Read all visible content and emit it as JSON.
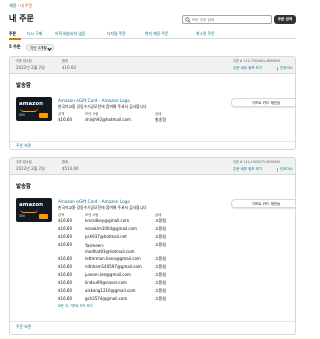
{
  "breadcrumb": {
    "account": "계정",
    "separator": "›",
    "current": "내 주문"
  },
  "page_title": "내 주문",
  "search": {
    "placeholder": "모든 주문 검색",
    "button_label": "주문 검색"
  },
  "tabs": [
    "주문",
    "다시 구매",
    "아직 배송되지 않음",
    "디지털 주문",
    "현지 매장 주문",
    "취소된 주문"
  ],
  "summary": {
    "count": "5 주문",
    "range": "지난 3개월"
  },
  "orders": [
    {
      "header": {
        "placed_label": "주문 접수됨",
        "placed_value": "2022년 2월 2일",
        "total_label": "합계",
        "total_value": "$16.60",
        "order_number": "주문 # 112-7553061-4609025",
        "details_link": "주문 세부 정보 보기",
        "invoice_link": "인보이스"
      },
      "status": "발송함",
      "product_link": "Amazon eGift Card - Amazon Logo",
      "message": "한국어교환 강동수기공모전에 참여해 주셔서 감사합니다",
      "amount_label": "금액",
      "to_label": "보낸 사람",
      "status_label": "상태",
      "rows": [
        {
          "amount": "$16.60",
          "recipient": "shinjh92@hotmail.com",
          "status": "발송함"
        }
      ],
      "gift_button": "기프트 카드 재전송",
      "footer_link": "주문 보관"
    },
    {
      "header": {
        "placed_label": "주문 접수됨",
        "placed_value": "2022년 2월 2일",
        "total_label": "합계",
        "total_value": "$514.60",
        "order_number": "주문 # 112-1903375-4920045",
        "details_link": "주문 세부 정보 보기",
        "invoice_link": "인보이스"
      },
      "status": "발송함",
      "product_link": "Amazon eGift Card - Amazon Logo",
      "message": "한국어교환 강동수기공모전에 참여해 주셔서 감사합니다",
      "amount_label": "금액",
      "to_label": "보낸 사람",
      "status_label": "상태",
      "rows": [
        {
          "amount": "$16.60",
          "recipient": "krnisdkey@gmail.com",
          "status": "고환됨"
        },
        {
          "amount": "$16.60",
          "recipient": "sonakim1004@gmail.com",
          "status": "고환됨"
        },
        {
          "amount": "$16.60",
          "recipient": "psh937@hotmail.net",
          "status": "고환됨"
        },
        {
          "amount": "$16.60",
          "recipient": "Yasmeen-\nmedhat93@hotmail.com",
          "status": "고환됨"
        },
        {
          "amount": "$16.60",
          "recipient": "letterman.hana@gmail.com",
          "status": "고환됨"
        },
        {
          "amount": "$16.60",
          "recipient": "nithham140597@gmail.com",
          "status": "고환됨"
        },
        {
          "amount": "$16.60",
          "recipient": "juneon.lee@gmail.com",
          "status": "고환됨"
        },
        {
          "amount": "$16.60",
          "recipient": "lindsu99@naver.com",
          "status": "고환됨"
        },
        {
          "amount": "$16.60",
          "recipient": "alskang1210@gmail.com",
          "status": "고환됨"
        },
        {
          "amount": "$16.60",
          "recipient": "gsh3574@gmail.com",
          "status": "고환됨"
        }
      ],
      "more_link": "모든 31 기프트 카드 보기",
      "gift_button": "기프트 카드 재전송",
      "footer_link": "주문 보관"
    }
  ]
}
